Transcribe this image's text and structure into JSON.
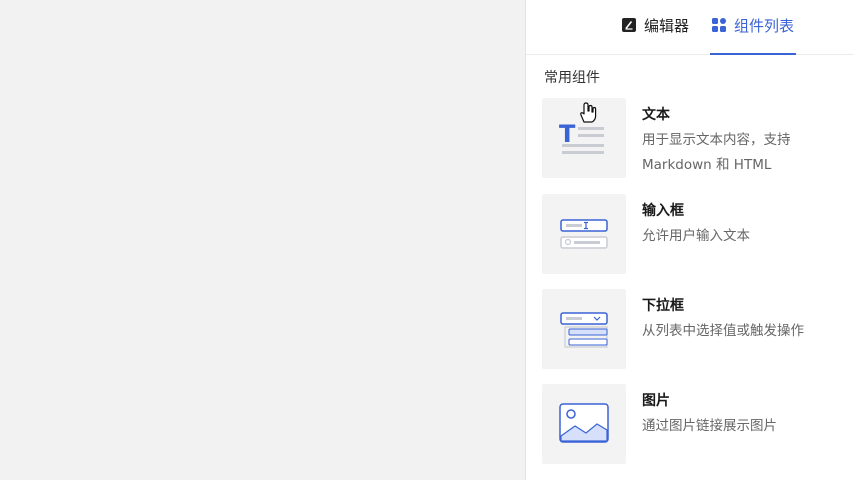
{
  "tabs": [
    {
      "label": "编辑器",
      "icon": "editor-icon",
      "active": false
    },
    {
      "label": "组件列表",
      "icon": "grid-icon",
      "active": true
    }
  ],
  "section_title": "常用组件",
  "components": [
    {
      "title": "文本",
      "desc": "用于显示文本内容，支持 Markdown 和 HTML",
      "icon": "text-component-icon"
    },
    {
      "title": "输入框",
      "desc": "允许用户输入文本",
      "icon": "input-component-icon"
    },
    {
      "title": "下拉框",
      "desc": "从列表中选择值或触发操作",
      "icon": "dropdown-component-icon"
    },
    {
      "title": "图片",
      "desc": "通过图片链接展示图片",
      "icon": "image-component-icon"
    }
  ],
  "colors": {
    "accent": "#3a63d6",
    "thumb_line": "#c9ccd3",
    "thumb_fill": "#d6e0fb"
  }
}
